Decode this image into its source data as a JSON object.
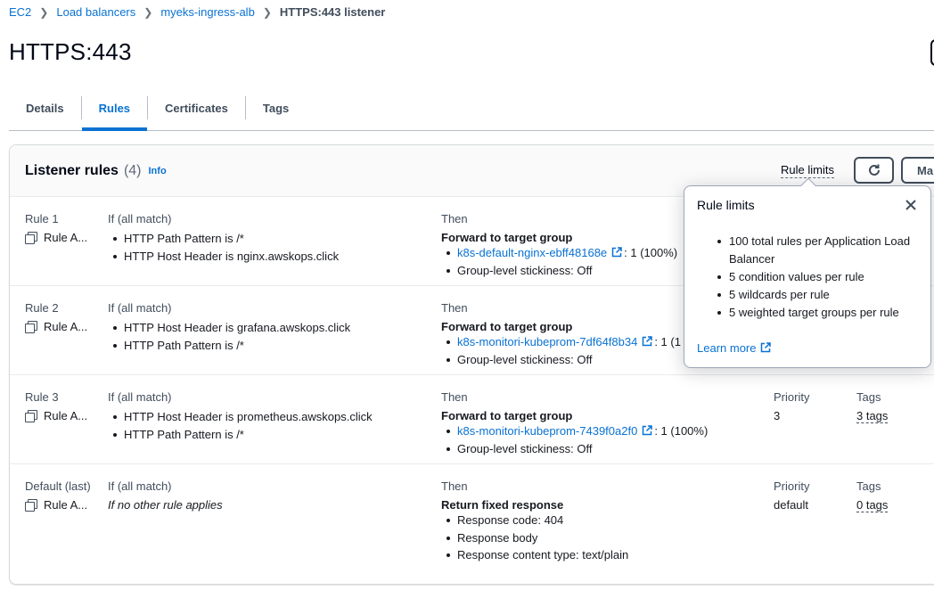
{
  "breadcrumb": {
    "items": [
      "EC2",
      "Load balancers",
      "myeks-ingress-alb"
    ],
    "current": "HTTPS:443 listener"
  },
  "page": {
    "title": "HTTPS:443"
  },
  "tabs": [
    {
      "label": "Details",
      "active": false
    },
    {
      "label": "Rules",
      "active": true
    },
    {
      "label": "Certificates",
      "active": false
    },
    {
      "label": "Tags",
      "active": false
    }
  ],
  "listener_rules": {
    "title": "Listener rules",
    "count": "(4)",
    "info": "Info",
    "rule_limits_label": "Rule limits",
    "manage_label": "Ma",
    "column_labels": {
      "if": "If (all match)",
      "then": "Then",
      "priority": "Priority",
      "tags": "Tags"
    },
    "rules": [
      {
        "name": "Rule 1",
        "arn": "Rule A...",
        "conditions": [
          "HTTP Path Pattern is /*",
          "HTTP Host Header is nginx.awskops.click"
        ],
        "action": "Forward to target group",
        "target_group": "k8s-default-nginx-ebff48168e",
        "weight": ": 1 (100%)",
        "stickiness": "Group-level stickiness: Off"
      },
      {
        "name": "Rule 2",
        "arn": "Rule A...",
        "conditions": [
          "HTTP Host Header is grafana.awskops.click",
          "HTTP Path Pattern is /*"
        ],
        "action": "Forward to target group",
        "target_group": "k8s-monitori-kubeprom-7df64f8b34",
        "weight": ": 1 (1",
        "stickiness": "Group-level stickiness: Off"
      },
      {
        "name": "Rule 3",
        "arn": "Rule A...",
        "conditions": [
          "HTTP Host Header is prometheus.awskops.click",
          "HTTP Path Pattern is /*"
        ],
        "action": "Forward to target group",
        "target_group": "k8s-monitori-kubeprom-7439f0a2f0",
        "weight": ": 1 (100%)",
        "stickiness": "Group-level stickiness: Off",
        "priority": "3",
        "tags": "3 tags"
      },
      {
        "name": "Default (last)",
        "arn": "Rule A...",
        "condition_text": "If no other rule applies",
        "action": "Return fixed response",
        "details": [
          "Response code: 404",
          "Response body",
          "Response content type: text/plain"
        ],
        "priority": "default",
        "tags": "0 tags"
      }
    ]
  },
  "popover": {
    "title": "Rule limits",
    "items": [
      "100 total rules per Application Load Balancer",
      "5 condition values per rule",
      "5 wildcards per rule",
      "5 weighted target groups per rule"
    ],
    "learn_more": "Learn more"
  },
  "colors": {
    "link": "#0972d3",
    "text": "#16191f",
    "muted": "#414d5c",
    "border": "#e9ebed"
  }
}
